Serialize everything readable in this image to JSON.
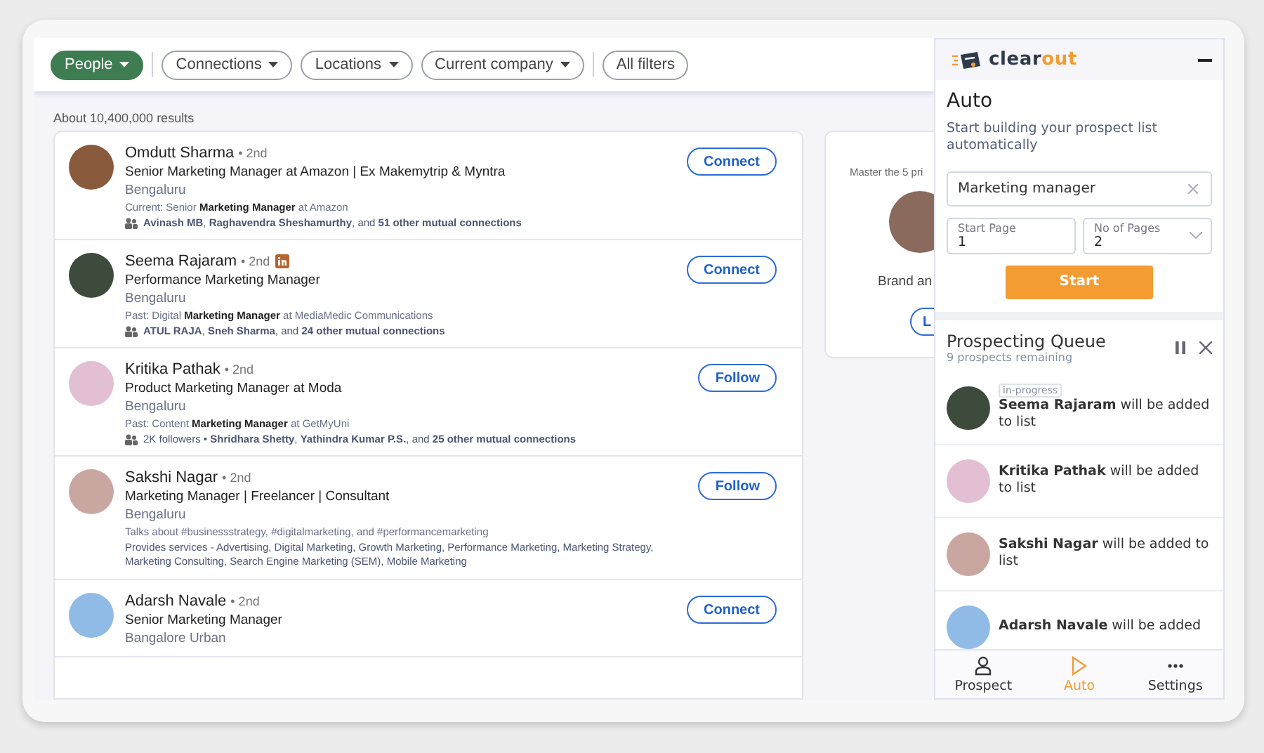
{
  "filters": [
    {
      "label": "People",
      "selected": true,
      "caret": true
    },
    {
      "label": "Connections",
      "selected": false,
      "caret": true
    },
    {
      "label": "Locations",
      "selected": false,
      "caret": true
    },
    {
      "label": "Current company",
      "selected": false,
      "caret": true
    },
    {
      "label": "All filters",
      "selected": false,
      "caret": false
    }
  ],
  "results_count": "About 10,400,000 results",
  "results": [
    {
      "name": "Omdutt Sharma",
      "degree": "• 2nd",
      "premium": false,
      "headline": "Senior Marketing Manager at Amazon | Ex Makemytrip & Myntra",
      "location": "Bengaluru",
      "insight": "Current: Senior **Marketing Manager** at Amazon",
      "mutual": "**Avinash MB**, **Raghavendra Sheshamurthy**, and **51 other mutual connections**",
      "action": "Connect"
    },
    {
      "name": "Seema Rajaram",
      "degree": "• 2nd",
      "premium": true,
      "headline": "Performance Marketing Manager",
      "location": "Bengaluru",
      "insight": "Past: Digital **Marketing Manager** at MediaMedic Communications",
      "mutual": "**ATUL RAJA**, **Sneh Sharma**, and **24 other mutual connections**",
      "action": "Connect"
    },
    {
      "name": "Kritika Pathak",
      "degree": "• 2nd",
      "premium": false,
      "headline": "Product Marketing Manager at Moda",
      "location": "Bengaluru",
      "insight": "Past: Content **Marketing Manager** at GetMyUni",
      "mutual": "2K followers • **Shridhara Shetty**, **Yathindra Kumar P.S.**, and **25 other mutual connections**",
      "action": "Follow"
    },
    {
      "name": "Sakshi Nagar",
      "degree": "• 2nd",
      "premium": false,
      "headline": "Marketing Manager | Freelancer | Consultant",
      "location": "Bengaluru",
      "insight": "Talks about #businessstrategy, #digitalmarketing, and #performancemarketing",
      "services": "Provides services - Advertising, Digital Marketing, Growth Marketing, Performance Marketing, Marketing Strategy, Marketing Consulting, Search Engine Marketing (SEM), Mobile Marketing",
      "action": "Follow"
    },
    {
      "name": "Adarsh Navale",
      "degree": "• 2nd",
      "premium": false,
      "headline": "Senior Marketing Manager",
      "location": "Bangalore Urban",
      "action": "Connect"
    }
  ],
  "promo": {
    "text": "Master the 5 pri",
    "title": "Brand an",
    "button": "L"
  },
  "panel": {
    "logo": {
      "text": "clear",
      "accent": "out"
    },
    "title": "Auto",
    "subtitle": "Start building your prospect list automatically",
    "search": {
      "value": "Marketing manager"
    },
    "start_page": {
      "label": "Start Page",
      "value": "1"
    },
    "pages": {
      "label": "No of Pages",
      "value": "2"
    },
    "start_button": "Start",
    "queue": {
      "title": "Prospecting Queue",
      "remaining": "9 prospects remaining",
      "items": [
        {
          "status": "in-progress",
          "text": "**Seema Rajaram** will be added to list"
        },
        {
          "text": "**Kritika Pathak** will be added to list"
        },
        {
          "text": "**Sakshi Nagar** will be added to list"
        },
        {
          "text": "**Adarsh Navale** will be added"
        }
      ]
    },
    "nav": [
      {
        "label": "Prospect",
        "kind": "person",
        "selected": false
      },
      {
        "label": "Auto",
        "kind": "play",
        "selected": true
      },
      {
        "label": "Settings",
        "kind": "dots",
        "selected": false
      }
    ]
  }
}
